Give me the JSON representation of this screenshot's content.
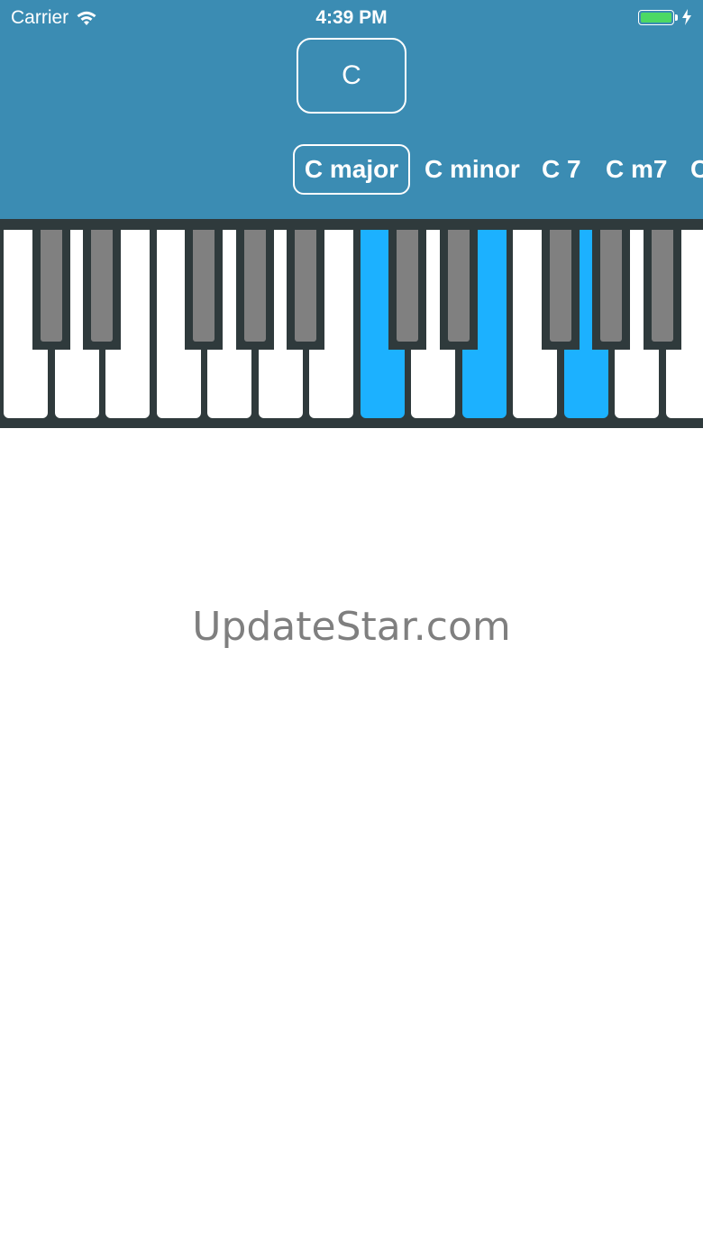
{
  "status_bar": {
    "carrier": "Carrier",
    "time": "4:39 PM",
    "battery_color": "#4cd964"
  },
  "key_selector": {
    "label": "C"
  },
  "chord_tabs": [
    {
      "label": "C major",
      "selected": true
    },
    {
      "label": "C minor",
      "selected": false
    },
    {
      "label": "C 7",
      "selected": false
    },
    {
      "label": "C m7",
      "selected": false
    },
    {
      "label": "C",
      "selected": false
    }
  ],
  "keyboard": {
    "highlighted_keys": [
      "C",
      "E",
      "G"
    ],
    "highlight_color": "#1cb1ff"
  },
  "watermark": "UpdateStar.com",
  "colors": {
    "header": "#3b8cb3",
    "keyboard_bg": "#2f3a3c",
    "black_key": "#808080"
  }
}
